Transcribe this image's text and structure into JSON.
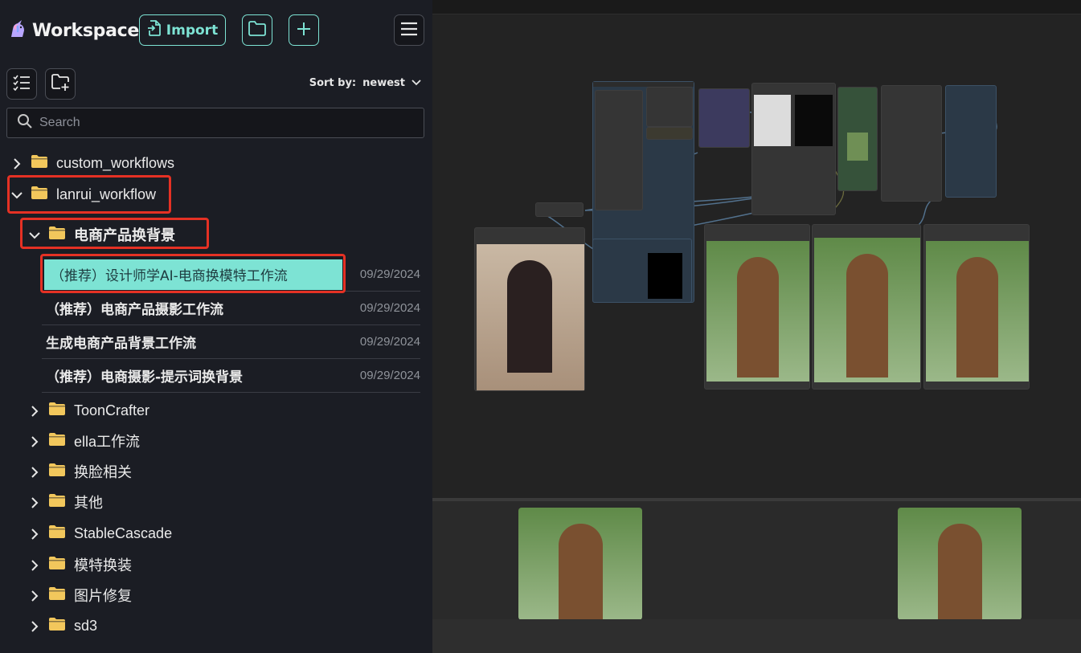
{
  "sidebar": {
    "brand": "Workspace",
    "import_label": "Import",
    "sort_label": "Sort by:",
    "sort_value": "newest",
    "search_placeholder": "Search",
    "tree": [
      {
        "label": "custom_workflows",
        "expanded": false
      },
      {
        "label": "lanrui_workflow",
        "expanded": true
      },
      {
        "label": "电商产品换背景",
        "expanded": true
      },
      {
        "label": "ToonCrafter",
        "expanded": false
      },
      {
        "label": "ella工作流",
        "expanded": false
      },
      {
        "label": "换脸相关",
        "expanded": false
      },
      {
        "label": "其他",
        "expanded": false
      },
      {
        "label": "StableCascade",
        "expanded": false
      },
      {
        "label": "模特换装",
        "expanded": false
      },
      {
        "label": "图片修复",
        "expanded": false
      },
      {
        "label": "sd3",
        "expanded": false
      }
    ],
    "workflows": [
      {
        "name": "（推荐）设计师学AI-电商换模特工作流",
        "date": "09/29/2024",
        "active": true
      },
      {
        "name": "（推荐）电商产品摄影工作流",
        "date": "09/29/2024",
        "active": false
      },
      {
        "name": "生成电商产品背景工作流",
        "date": "09/29/2024",
        "active": false
      },
      {
        "name": "（推荐）电商摄影-提示词换背景",
        "date": "09/29/2024",
        "active": false
      }
    ]
  },
  "icons": {
    "brand": "unicorn-icon",
    "import": "file-import-icon",
    "folder": "folder-icon",
    "plus": "plus-icon",
    "menu": "hamburger-icon",
    "list": "checklist-icon",
    "new_folder": "folder-plus-icon",
    "search": "search-icon",
    "chevron": "chevron-icon"
  },
  "colors": {
    "accent": "#7de3d4",
    "highlight_box": "#e53124",
    "folder": "#f2c75c",
    "sidebar_bg": "#1b1d24",
    "canvas_bg": "#232323"
  }
}
